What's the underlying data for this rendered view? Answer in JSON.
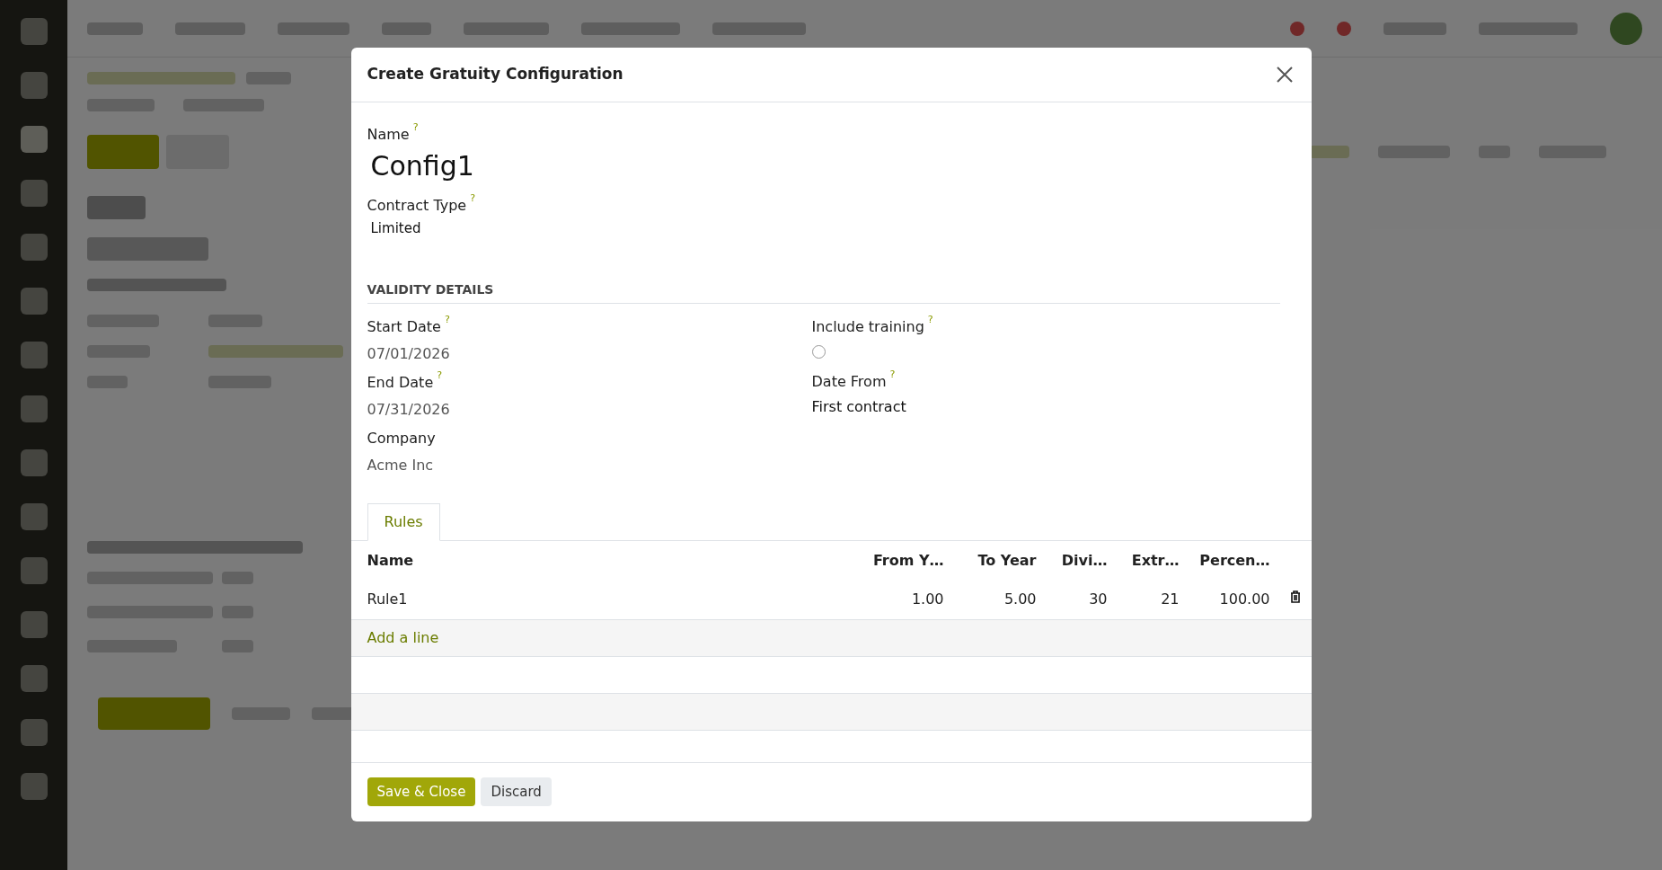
{
  "dialog": {
    "title": "Create Gratuity Configuration",
    "name": {
      "label": "Name",
      "help": "?",
      "value": "Config1"
    },
    "contract_type": {
      "label": "Contract Type",
      "help": "?",
      "value": "Limited"
    },
    "section_title": "VALIDITY DETAILS",
    "left_fields": [
      {
        "label": "Start Date",
        "help": "?",
        "value": "07/01/2026"
      },
      {
        "label": "End Date",
        "help": "?",
        "value": "07/31/2026"
      },
      {
        "label": "Company",
        "value": "Acme Inc"
      }
    ],
    "include_training": {
      "label": "Include training",
      "help": "?",
      "checked": false
    },
    "date_from": {
      "label": "Date From",
      "help": "?",
      "value": "First contract"
    },
    "tabs": [
      {
        "label": "Rules",
        "selected": true
      }
    ],
    "table": {
      "columns": [
        "Name",
        "From Y…",
        "To Year",
        "Divi…",
        "Extr…",
        "Percen…"
      ],
      "rows": [
        {
          "cells": [
            "Rule1",
            "1.00",
            "5.00",
            "30",
            "21",
            "100.00"
          ]
        }
      ],
      "add_line": "Add a line"
    },
    "buttons": [
      {
        "label": "Save & Close",
        "kind": "primary"
      },
      {
        "label": "Discard",
        "kind": "secondary"
      }
    ]
  }
}
